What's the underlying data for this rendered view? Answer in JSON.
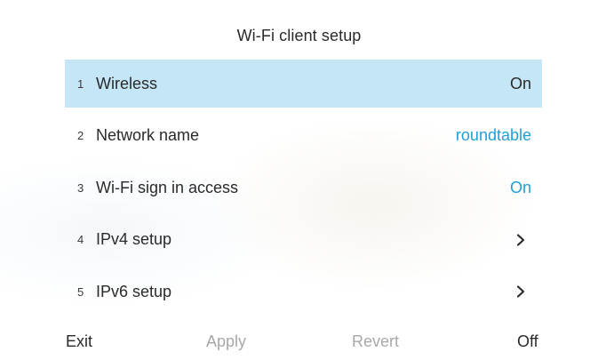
{
  "title": "Wi-Fi client setup",
  "items": [
    {
      "num": "1",
      "label": "Wireless",
      "value": "On"
    },
    {
      "num": "2",
      "label": "Network name",
      "value": "roundtable"
    },
    {
      "num": "3",
      "label": "Wi-Fi sign in access",
      "value": "On"
    },
    {
      "num": "4",
      "label": "IPv4 setup",
      "icon": "chevron-right-icon"
    },
    {
      "num": "5",
      "label": "IPv6 setup",
      "icon": "chevron-right-icon"
    }
  ],
  "softkeys": {
    "exit": "Exit",
    "apply": "Apply",
    "revert": "Revert",
    "off": "Off"
  },
  "colors": {
    "selected_row": "#c5e6f6",
    "accent_value": "#1f9fd6",
    "disabled_softkey": "#a8a8a8"
  }
}
